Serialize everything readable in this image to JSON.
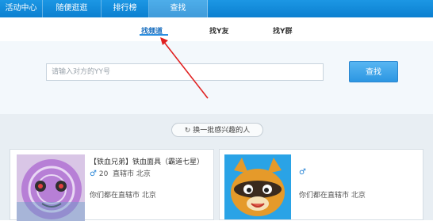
{
  "top_tabs": [
    {
      "label": "活动中心"
    },
    {
      "label": "随便逛逛"
    },
    {
      "label": "排行榜"
    },
    {
      "label": "查找"
    }
  ],
  "sub_tabs": [
    {
      "label": "找频道"
    },
    {
      "label": "找Y友"
    },
    {
      "label": "找Y群"
    }
  ],
  "search": {
    "placeholder": "请输入对方的YY号",
    "button_label": "查找"
  },
  "refresh": {
    "label": "换一批感兴趣的人"
  },
  "cards": [
    {
      "name": "【铁血兄弟】铁血面具（霸道七星）",
      "age": "20",
      "location": "直辖市 北京",
      "tagline": "你们都在直辖市 北京"
    },
    {
      "name": "",
      "age": "",
      "location": "直辖市 北京",
      "tagline": "你们都在直辖市 北京"
    }
  ],
  "colors": {
    "topbar": "#0b7fd0",
    "accent": "#2b8ee0",
    "annotation_arrow": "#e02020"
  }
}
